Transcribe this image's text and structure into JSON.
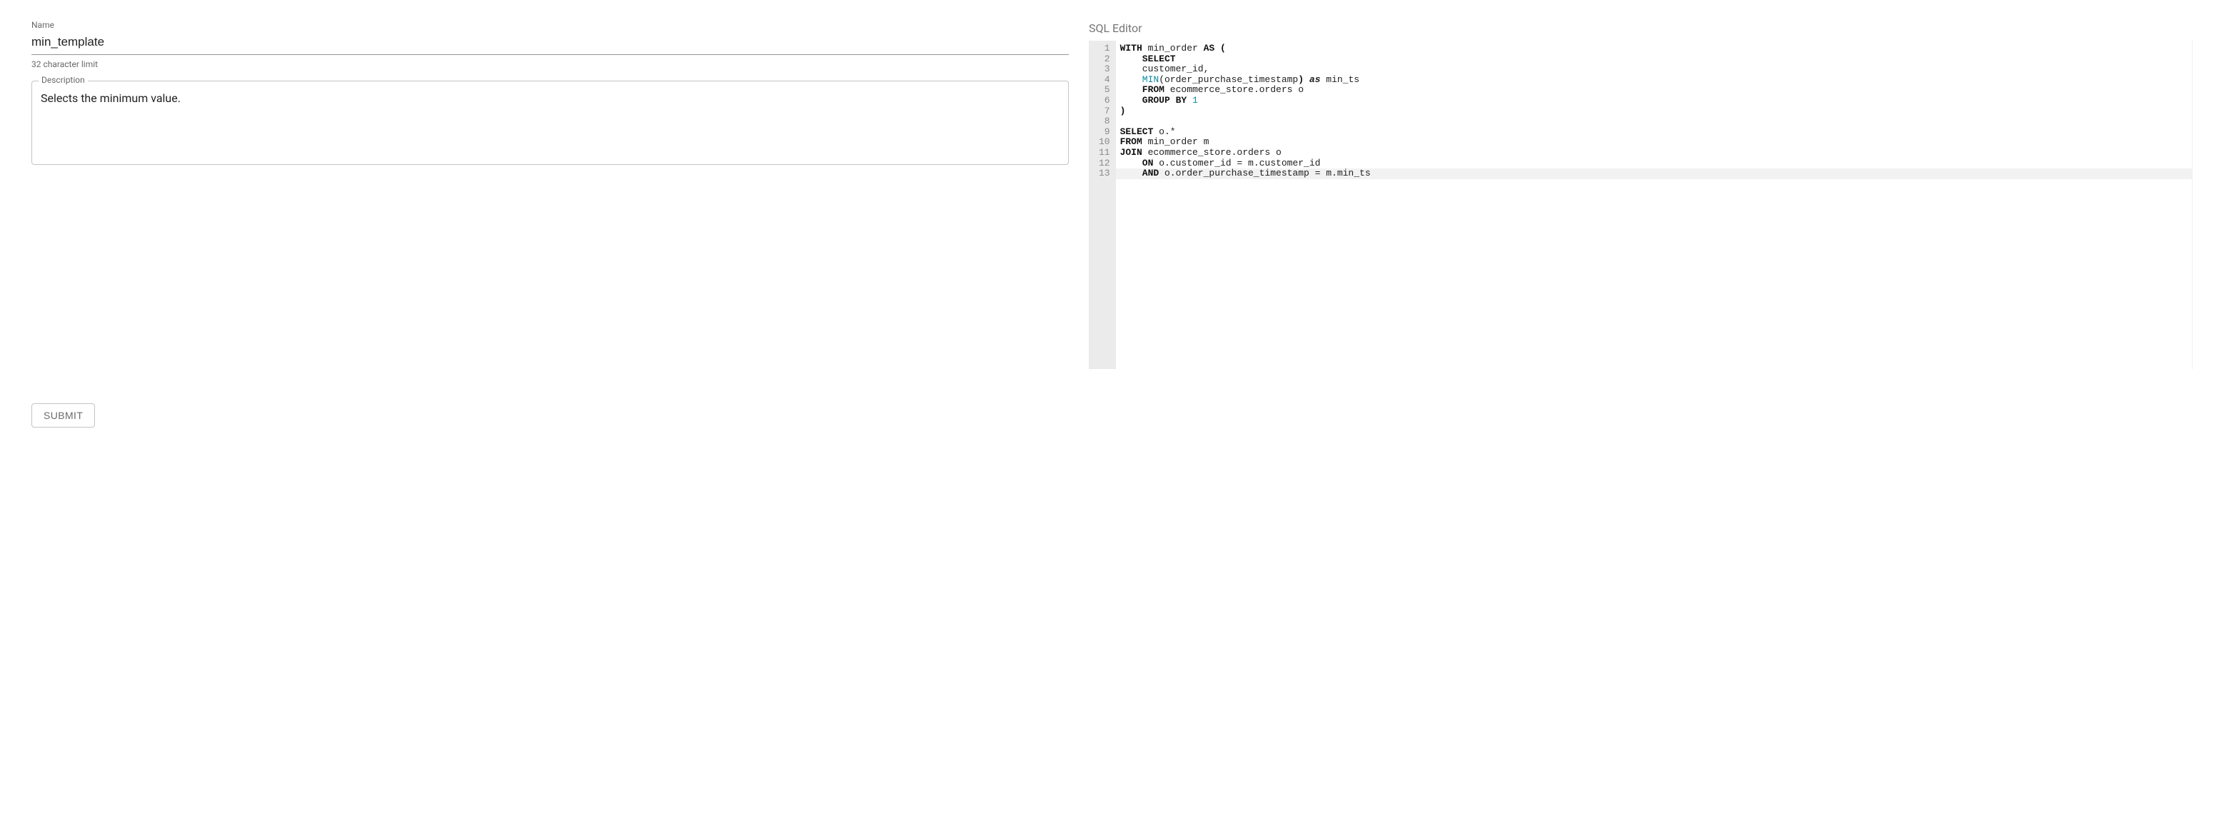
{
  "form": {
    "name_label": "Name",
    "name_value": "min_template",
    "name_helper": "32 character limit",
    "desc_label": "Description",
    "desc_value": "Selects the minimum value.",
    "submit_label": "SUBMIT"
  },
  "editor": {
    "title": "SQL Editor",
    "highlighted_line": 13,
    "lines": [
      [
        [
          "kw",
          "WITH"
        ],
        [
          "pl",
          " min_order "
        ],
        [
          "kw",
          "AS"
        ],
        [
          "pl",
          " "
        ],
        [
          "kw",
          "("
        ]
      ],
      [
        [
          "pl",
          "    "
        ],
        [
          "kw",
          "SELECT"
        ]
      ],
      [
        [
          "pl",
          "    customer_id,"
        ]
      ],
      [
        [
          "pl",
          "    "
        ],
        [
          "fn",
          "MIN"
        ],
        [
          "pl",
          "(order_purchase_timestamp"
        ],
        [
          "kw",
          ")"
        ],
        [
          "pl",
          " "
        ],
        [
          "it",
          "as"
        ],
        [
          "pl",
          " min_ts"
        ]
      ],
      [
        [
          "pl",
          "    "
        ],
        [
          "kw",
          "FROM"
        ],
        [
          "pl",
          " ecommerce_store.orders o"
        ]
      ],
      [
        [
          "pl",
          "    "
        ],
        [
          "kw",
          "GROUP BY"
        ],
        [
          "pl",
          " "
        ],
        [
          "num",
          "1"
        ]
      ],
      [
        [
          "kw",
          ")"
        ]
      ],
      [
        [
          "pl",
          ""
        ]
      ],
      [
        [
          "kw",
          "SELECT"
        ],
        [
          "pl",
          " o.*"
        ]
      ],
      [
        [
          "kw",
          "FROM"
        ],
        [
          "pl",
          " min_order m"
        ]
      ],
      [
        [
          "kw",
          "JOIN"
        ],
        [
          "pl",
          " ecommerce_store.orders o"
        ]
      ],
      [
        [
          "pl",
          "    "
        ],
        [
          "kw",
          "ON"
        ],
        [
          "pl",
          " o.customer_id = m.customer_id"
        ]
      ],
      [
        [
          "pl",
          "    "
        ],
        [
          "kw",
          "AND"
        ],
        [
          "pl",
          " o.order_purchase_timestamp = m.min_ts"
        ]
      ]
    ]
  }
}
